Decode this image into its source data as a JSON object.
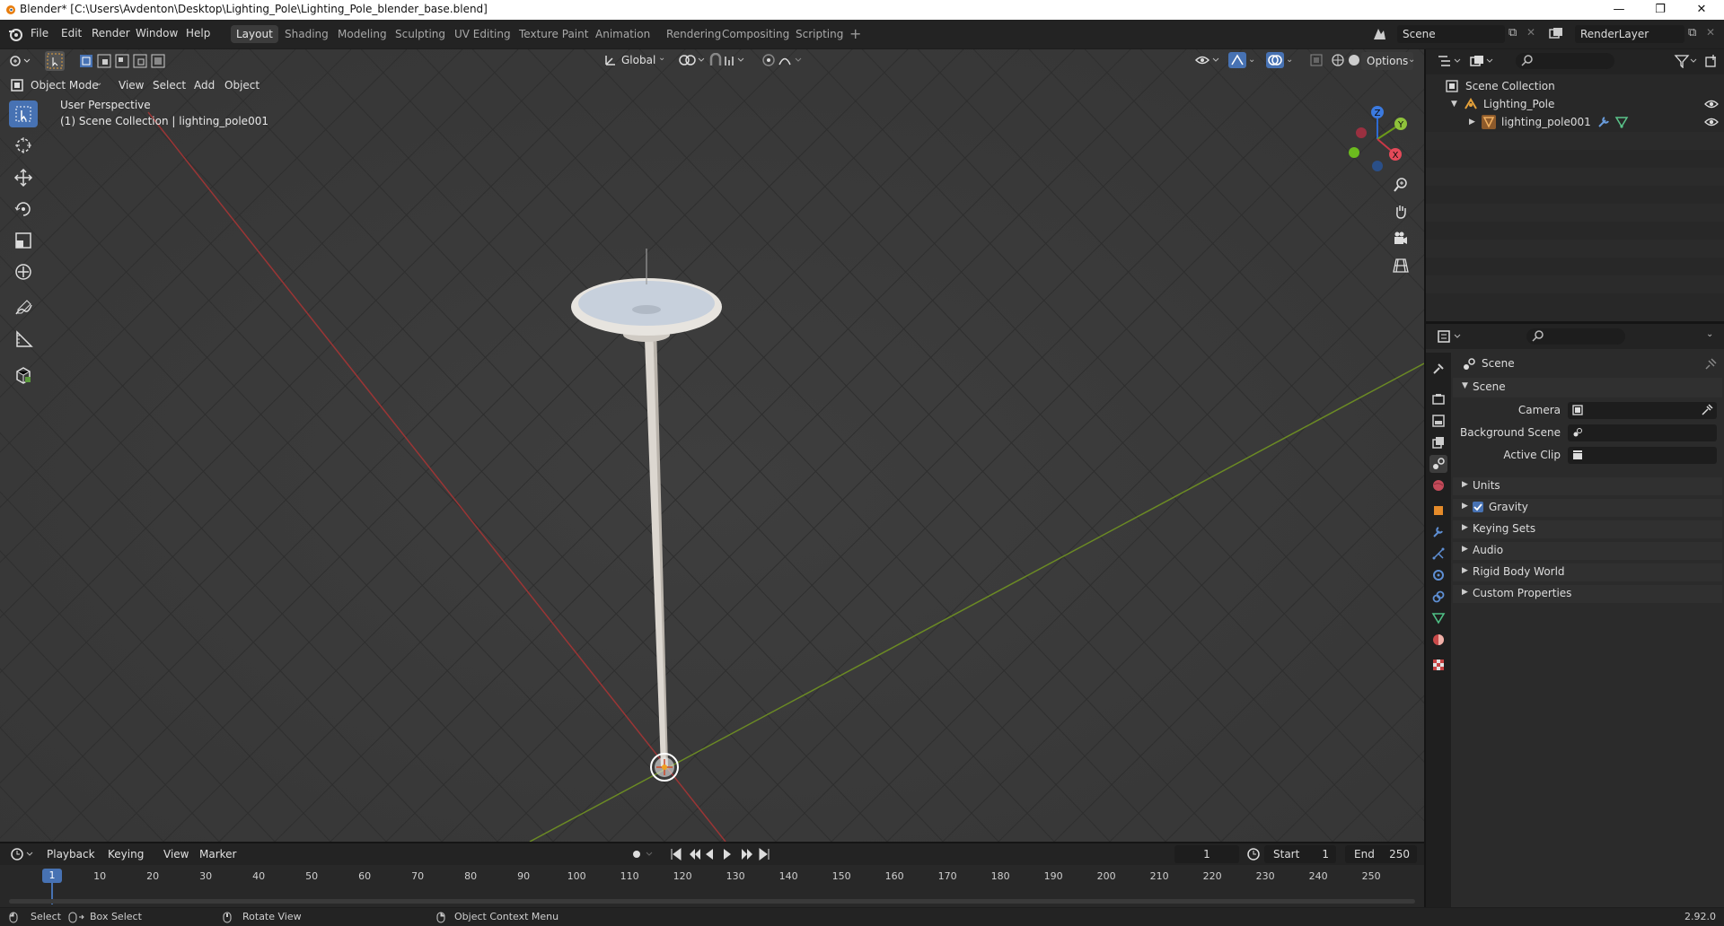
{
  "window": {
    "title": "Blender* [C:\\Users\\Avdenton\\Desktop\\Lighting_Pole\\Lighting_Pole_blender_base.blend]",
    "minimize": "—",
    "maximize": "❐",
    "close": "✕"
  },
  "menu": [
    "File",
    "Edit",
    "Render",
    "Window",
    "Help"
  ],
  "workspaces": [
    "Layout",
    "Shading",
    "Modeling",
    "Sculpting",
    "UV Editing",
    "Texture Paint",
    "Animation",
    "Rendering",
    "Compositing",
    "Scripting"
  ],
  "active_workspace": "Layout",
  "scene_name": "Scene",
  "view_layer": "RenderLayer",
  "viewport": {
    "mode": "Object Mode",
    "menus": [
      "View",
      "Select",
      "Add",
      "Object"
    ],
    "transform_orientation": "Global",
    "options_label": "Options",
    "overlay_title": "User Perspective",
    "overlay_subtitle": "(1) Scene Collection | lighting_pole001",
    "gizmo": {
      "z": "Z",
      "y": "Y",
      "x": "X"
    }
  },
  "outliner": {
    "root": "Scene Collection",
    "collection": "Lighting_Pole",
    "object": "lighting_pole001"
  },
  "properties": {
    "header": "Scene",
    "section": "Scene",
    "fields": [
      {
        "label": "Camera",
        "value": ""
      },
      {
        "label": "Background Scene",
        "value": ""
      },
      {
        "label": "Active Clip",
        "value": ""
      }
    ],
    "panels": [
      "Units",
      "Gravity",
      "Keying Sets",
      "Audio",
      "Rigid Body World",
      "Custom Properties"
    ],
    "gravity_checked": true
  },
  "timeline": {
    "menus": [
      "Playback",
      "Keying",
      "View",
      "Marker"
    ],
    "current_frame": "1",
    "start_label": "Start",
    "start": "1",
    "end_label": "End",
    "end": "250",
    "ticks": [
      1,
      10,
      20,
      30,
      40,
      50,
      60,
      70,
      80,
      90,
      100,
      110,
      120,
      130,
      140,
      150,
      160,
      170,
      180,
      190,
      200,
      210,
      220,
      230,
      240,
      250
    ]
  },
  "statusbar": {
    "items": [
      "Select",
      "Box Select",
      "Rotate View",
      "Object Context Menu"
    ],
    "version": "2.92.0"
  }
}
